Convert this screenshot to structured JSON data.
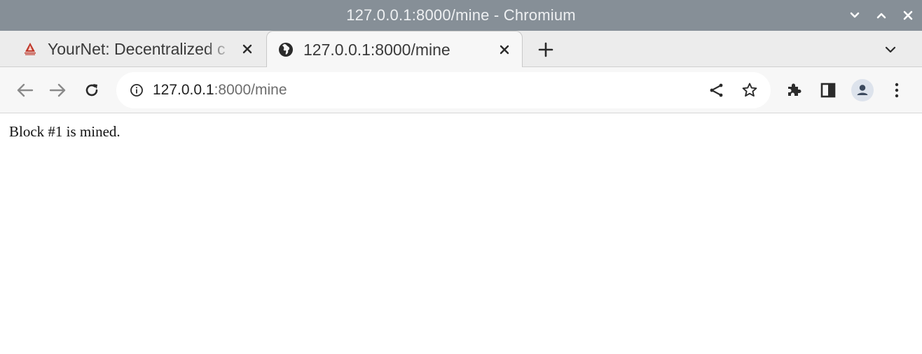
{
  "window": {
    "title": "127.0.0.1:8000/mine - Chromium"
  },
  "tabs": [
    {
      "title": "YourNet: Decentralized c",
      "favicon": "tent-logo-icon",
      "active": false
    },
    {
      "title": "127.0.0.1:8000/mine",
      "favicon": "globe-icon",
      "active": true
    }
  ],
  "address_bar": {
    "host": "127.0.0.1",
    "path": ":8000/mine"
  },
  "page": {
    "body_text": "Block #1 is mined."
  },
  "colors": {
    "titlebar": "#868f97",
    "tabstrip": "#ececec",
    "toolbar": "#f7f7f7",
    "favicon_accent": "#c0392b"
  }
}
